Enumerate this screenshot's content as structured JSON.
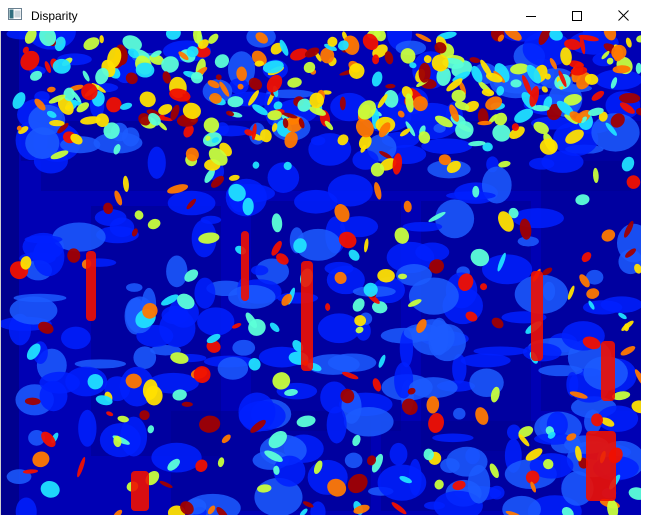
{
  "window": {
    "title": "Disparity",
    "icon": "opencv-window-icon",
    "controls": {
      "minimize_icon": "minimize-icon",
      "maximize_icon": "maximize-icon",
      "close_icon": "close-icon"
    }
  },
  "image": {
    "description_colormap": "jet",
    "colors": {
      "background": "#00008f",
      "dark_blue": "#0000b4",
      "blue": "#0020ff",
      "mid_blue": "#1c5cff",
      "cyan": "#20e0ff",
      "light_cyan": "#5cffd8",
      "green_yellow": "#c8ff3c",
      "yellow": "#ffe000",
      "orange": "#ff7800",
      "red": "#f01000",
      "dark_red": "#a00000"
    }
  }
}
